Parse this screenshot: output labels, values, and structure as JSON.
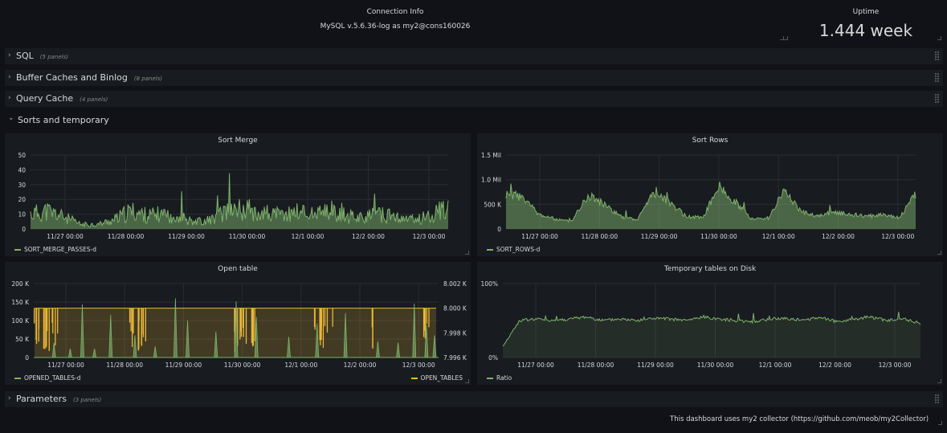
{
  "connection": {
    "title": "Connection Info",
    "value": "MySQL v.5.6.36-log as my2@cons160026"
  },
  "uptime": {
    "title": "Uptime",
    "value": "1.444 week"
  },
  "rows": [
    {
      "title": "SQL",
      "count": "(5 panels)",
      "collapsed": true
    },
    {
      "title": "Buffer Caches and Binlog",
      "count": "(8 panels)",
      "collapsed": true
    },
    {
      "title": "Query Cache",
      "count": "(4 panels)",
      "collapsed": true
    },
    {
      "title": "Sorts and temporary",
      "count": "",
      "collapsed": false
    },
    {
      "title": "Parameters",
      "count": "(3 panels)",
      "collapsed": true
    }
  ],
  "footer": {
    "text": "This dashboard uses my2 collector (https://github.com/meob/my2Collector)"
  },
  "colors": {
    "green": "#7eb26d",
    "yellow": "#eab839",
    "bg": "#111217",
    "panel": "#181b1f"
  },
  "chart_data": [
    {
      "type": "area",
      "title": "Sort Merge",
      "x_ticks": [
        "11/27 00:00",
        "11/28 00:00",
        "11/29 00:00",
        "11/30 00:00",
        "12/1 00:00",
        "12/2 00:00",
        "12/3 00:00"
      ],
      "y_ticks": [
        "0",
        "10",
        "20",
        "30",
        "40",
        "50"
      ],
      "ylim": [
        0,
        50
      ],
      "series": [
        {
          "name": "SORT_MERGE_PASSES-d",
          "color": "#7eb26d",
          "profile": [
            10,
            12,
            8,
            3,
            3,
            6,
            12,
            9,
            10,
            8,
            5,
            7,
            14,
            13,
            11,
            9,
            12,
            10,
            11,
            9,
            8,
            10,
            7,
            6,
            10,
            14
          ]
        }
      ],
      "legend": "bottom-left"
    },
    {
      "type": "area",
      "title": "Sort Rows",
      "x_ticks": [
        "11/27 00:00",
        "11/28 00:00",
        "11/29 00:00",
        "11/30 00:00",
        "12/1 00:00",
        "12/2 00:00",
        "12/3 00:00"
      ],
      "y_ticks": [
        "0",
        "500 K",
        "1.0 Mil",
        "1.5 Mil"
      ],
      "ylim": [
        0,
        1500000
      ],
      "series": [
        {
          "name": "SORT_ROWS-d",
          "color": "#7eb26d",
          "profile": [
            700000,
            650000,
            300000,
            200000,
            150000,
            700000,
            500000,
            250000,
            180000,
            750000,
            550000,
            250000,
            230000,
            850000,
            550000,
            200000,
            220000,
            800000,
            350000,
            250000,
            350000,
            300000,
            250000,
            300000,
            230000,
            700000
          ]
        }
      ],
      "legend": "bottom-left"
    },
    {
      "type": "line",
      "title": "Open table",
      "x_ticks": [
        "11/27 00:00",
        "11/28 00:00",
        "11/29 00:00",
        "11/30 00:00",
        "12/1 00:00",
        "12/2 00:00",
        "12/3 00:00"
      ],
      "y_ticks": [
        "0",
        "50 K",
        "100 K",
        "150 K",
        "200 K"
      ],
      "ylim": [
        0,
        200000
      ],
      "y2_ticks": [
        "7.996 K",
        "7.998 K",
        "8.000 K",
        "8.002 K"
      ],
      "y2lim": [
        7996,
        8002
      ],
      "series": [
        {
          "name": "OPENED_TABLES-d",
          "color": "#7eb26d",
          "axis": "left"
        },
        {
          "name": "OPEN_TABLES",
          "color": "#eab839",
          "axis": "right",
          "base": 8000
        }
      ],
      "legend": "bottom"
    },
    {
      "type": "area",
      "title": "Temporary tables on Disk",
      "x_ticks": [
        "11/27 00:00",
        "11/28 00:00",
        "11/29 00:00",
        "11/30 00:00",
        "12/1 00:00",
        "12/2 00:00",
        "12/3 00:00"
      ],
      "y_ticks": [
        "0%",
        "100%"
      ],
      "ylim": [
        0,
        100
      ],
      "series": [
        {
          "name": "Ratio",
          "color": "#7eb26d",
          "profile": [
            15,
            50,
            52,
            50,
            52,
            55,
            50,
            52,
            50,
            53,
            52,
            50,
            55,
            52,
            50,
            48,
            52,
            53,
            50,
            55,
            48,
            52,
            55,
            50,
            52,
            46
          ]
        }
      ],
      "legend": "bottom-left"
    }
  ]
}
